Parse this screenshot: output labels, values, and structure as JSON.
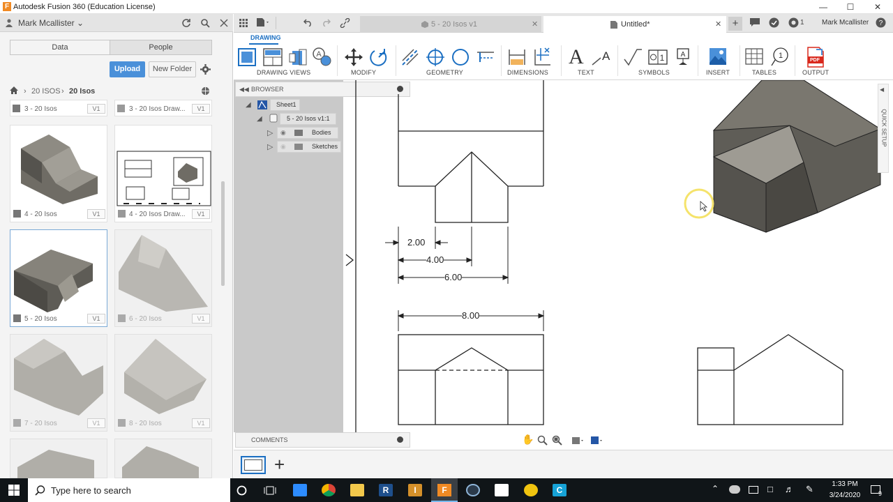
{
  "window": {
    "title": "Autodesk Fusion 360 (Education License)",
    "logo_letter": "F"
  },
  "data_panel": {
    "user": "Mark Mcallister",
    "tabs": [
      "Data",
      "People"
    ],
    "upload_label": "Upload",
    "new_folder_label": "New Folder",
    "breadcrumb": [
      "20 ISOS",
      "20 Isos"
    ],
    "items": [
      {
        "label": "3 - 20 Isos",
        "version": "V1"
      },
      {
        "label": "3 - 20 Isos Draw...",
        "version": "V1"
      },
      {
        "label": "4 - 20 Isos",
        "version": "V1"
      },
      {
        "label": "4 - 20 Isos Draw...",
        "version": "V1"
      },
      {
        "label": "5 - 20 Isos",
        "version": "V1"
      },
      {
        "label": "6 - 20 Isos",
        "version": "V1"
      },
      {
        "label": "7 - 20 Isos",
        "version": "V1"
      },
      {
        "label": "8 - 20 Isos",
        "version": "V1"
      }
    ]
  },
  "doc_tabs": [
    {
      "label": "5 - 20 Isos v1"
    },
    {
      "label": "Untitled*"
    }
  ],
  "account": {
    "notifications": "1",
    "user": "Mark Mcallister"
  },
  "ribbon": {
    "workspace": "DRAWING",
    "groups": [
      "DRAWING VIEWS",
      "MODIFY",
      "GEOMETRY",
      "DIMENSIONS",
      "TEXT",
      "SYMBOLS",
      "INSERT",
      "TABLES",
      "OUTPUT"
    ],
    "text_icon_glyph": "A",
    "pdf_label": "PDF"
  },
  "browser": {
    "title": "BROWSER",
    "sheet": "Sheet1",
    "component": "5 - 20 Isos v1:1",
    "children": [
      "Bodies",
      "Sketches"
    ]
  },
  "comments": {
    "title": "COMMENTS"
  },
  "quick_setup": "QUICK SETUP",
  "dimensions": [
    "2.00",
    "4.00",
    "6.00",
    "8.00"
  ],
  "taskbar": {
    "search_placeholder": "Type here to search",
    "time": "1:33 PM",
    "date": "3/24/2020",
    "notification_count": "9"
  },
  "colors": {
    "accent": "#4a90d9",
    "taskbar": "#101518",
    "model": "#7a776f"
  }
}
